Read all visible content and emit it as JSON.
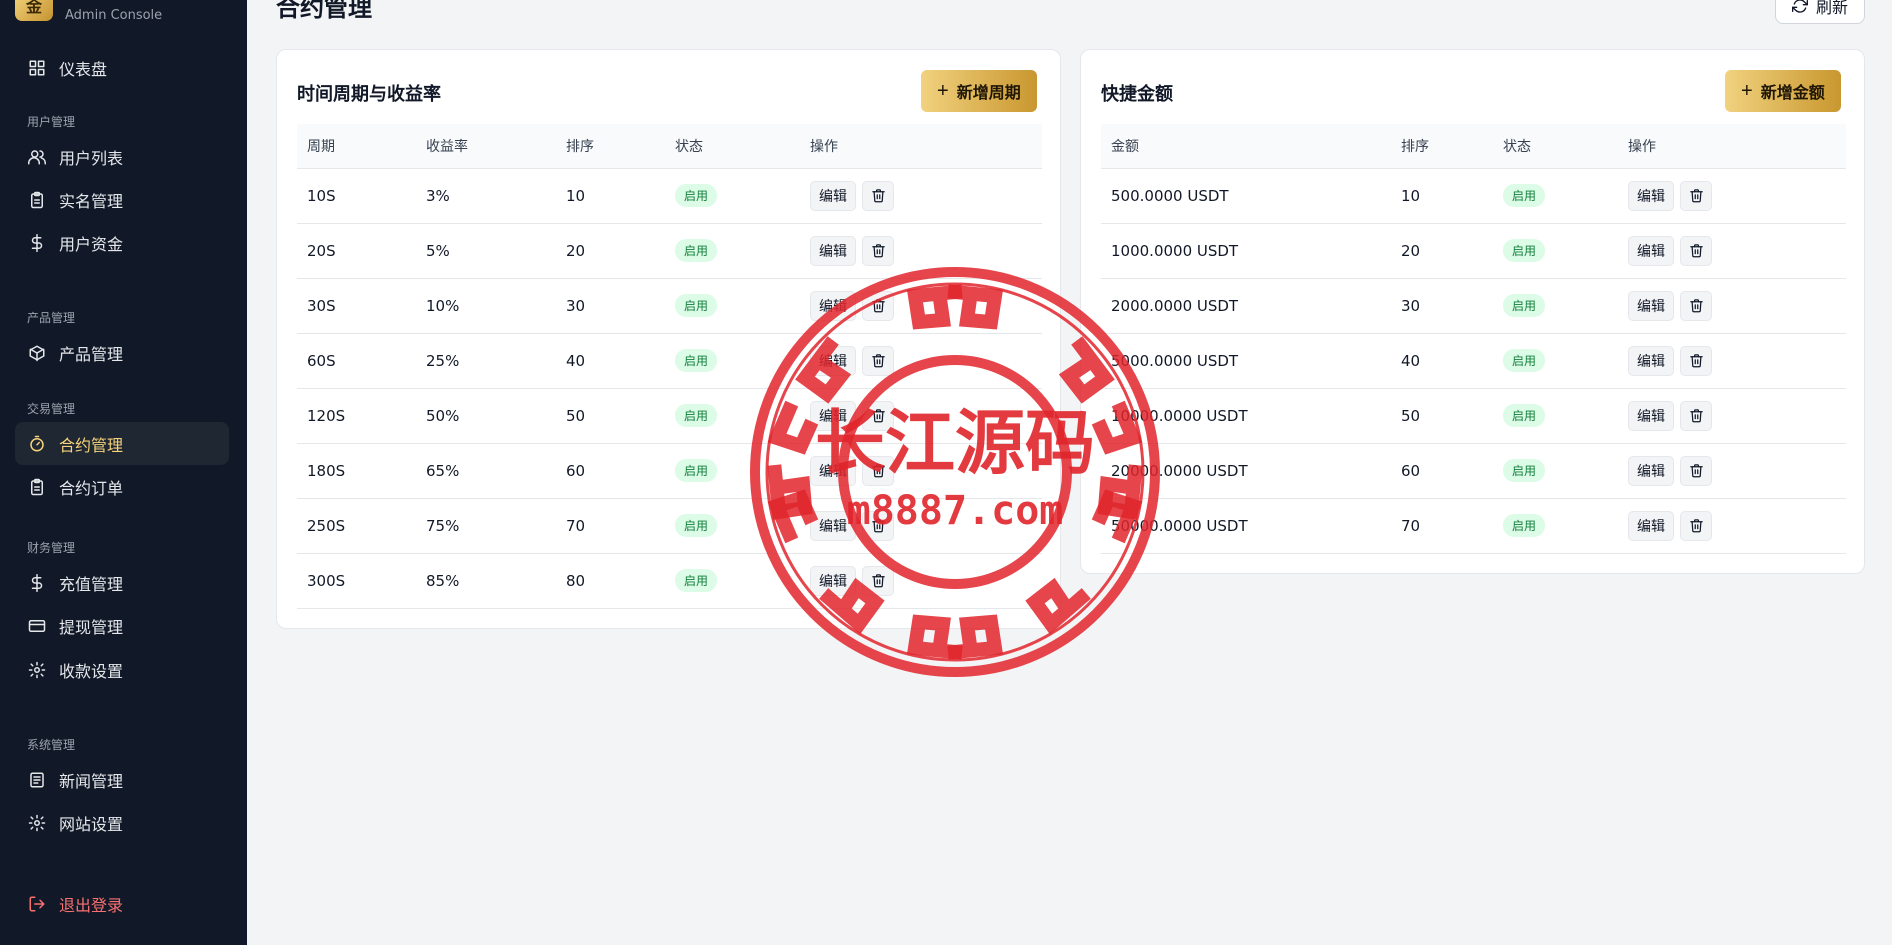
{
  "brand": {
    "logo_char": "金",
    "subtitle": "Admin Console"
  },
  "sidebar": {
    "items": [
      {
        "label": "仪表盘",
        "icon": "dashboard-icon"
      },
      {
        "section": "用户管理"
      },
      {
        "label": "用户列表",
        "icon": "users-icon"
      },
      {
        "label": "实名管理",
        "icon": "clipboard-icon"
      },
      {
        "label": "用户资金",
        "icon": "dollar-icon"
      },
      {
        "section": "产品管理"
      },
      {
        "label": "产品管理",
        "icon": "box-icon"
      },
      {
        "section": "交易管理"
      },
      {
        "label": "合约管理",
        "icon": "timer-icon",
        "active": true
      },
      {
        "label": "合约订单",
        "icon": "clipboard-icon"
      },
      {
        "section": "财务管理"
      },
      {
        "label": "充值管理",
        "icon": "dollar-icon"
      },
      {
        "label": "提现管理",
        "icon": "card-icon"
      },
      {
        "label": "收款设置",
        "icon": "gear-icon"
      },
      {
        "section": "系统管理"
      },
      {
        "label": "新闻管理",
        "icon": "newspaper-icon"
      },
      {
        "label": "网站设置",
        "icon": "gear-icon"
      }
    ],
    "logout": {
      "label": "退出登录",
      "icon": "logout-icon"
    }
  },
  "header": {
    "title": "合约管理",
    "refresh_label": "刷新",
    "refresh_icon": "refresh-icon"
  },
  "periods": {
    "title": "时间周期与收益率",
    "add_label": "新增周期",
    "columns": [
      "周期",
      "收益率",
      "排序",
      "状态",
      "操作"
    ],
    "rows": [
      [
        "10S",
        "3%",
        "10",
        "启用"
      ],
      [
        "20S",
        "5%",
        "20",
        "启用"
      ],
      [
        "30S",
        "10%",
        "30",
        "启用"
      ],
      [
        "60S",
        "25%",
        "40",
        "启用"
      ],
      [
        "120S",
        "50%",
        "50",
        "启用"
      ],
      [
        "180S",
        "65%",
        "60",
        "启用"
      ],
      [
        "250S",
        "75%",
        "70",
        "启用"
      ],
      [
        "300S",
        "85%",
        "80",
        "启用"
      ]
    ],
    "edit_label": "编辑"
  },
  "amounts": {
    "title": "快捷金额",
    "add_label": "新增金额",
    "columns": [
      "金额",
      "排序",
      "状态",
      "操作"
    ],
    "rows": [
      [
        "500.0000 USDT",
        "10",
        "启用"
      ],
      [
        "1000.0000 USDT",
        "20",
        "启用"
      ],
      [
        "2000.0000 USDT",
        "30",
        "启用"
      ],
      [
        "5000.0000 USDT",
        "40",
        "启用"
      ],
      [
        "10000.0000 USDT",
        "50",
        "启用"
      ],
      [
        "20000.0000 USDT",
        "60",
        "启用"
      ],
      [
        "50000.0000 USDT",
        "70",
        "启用"
      ]
    ],
    "edit_label": "编辑"
  },
  "watermark": {
    "line1": "长江源码",
    "line2": "m8887.com",
    "color": "#e0252b"
  },
  "colors": {
    "sidebar_bg": "#111827",
    "accent_gold": "#f6d37a",
    "status_green": "#15803d",
    "logout_red": "#f87171"
  }
}
